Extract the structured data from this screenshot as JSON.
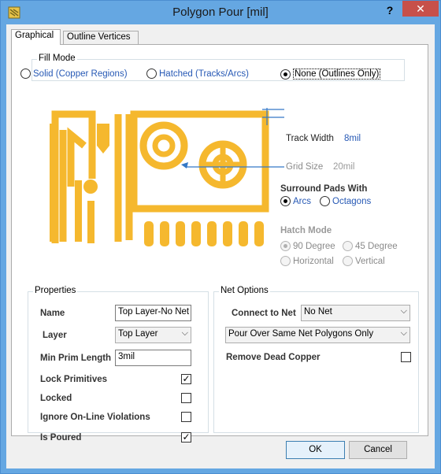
{
  "window": {
    "title": "Polygon Pour [mil]",
    "help": "?",
    "close": "✕"
  },
  "tabs": [
    {
      "label": "Graphical"
    },
    {
      "label": "Outline Vertices"
    }
  ],
  "fill_mode": {
    "title": "Fill Mode",
    "options": [
      {
        "label": "Solid (Copper Regions)",
        "checked": false
      },
      {
        "label": "Hatched (Tracks/Arcs)",
        "checked": false
      },
      {
        "label": "None (Outlines Only)",
        "checked": true
      }
    ]
  },
  "preview": {
    "track_width_label": "Track Width",
    "track_width_value": "8mil",
    "grid_size_label": "Grid Size",
    "grid_size_value": "20mil",
    "surround_label": "Surround Pads With",
    "surround_options": [
      {
        "label": "Arcs",
        "checked": true
      },
      {
        "label": "Octagons",
        "checked": false
      }
    ],
    "hatch_label": "Hatch Mode",
    "hatch_options": [
      {
        "label": "90 Degree",
        "checked": true
      },
      {
        "label": "45 Degree",
        "checked": false
      },
      {
        "label": "Horizontal",
        "checked": false
      },
      {
        "label": "Vertical",
        "checked": false
      }
    ],
    "copper_color": "#f5b82e"
  },
  "properties": {
    "title": "Properties",
    "name_label": "Name",
    "name_value": "Top Layer-No Net",
    "layer_label": "Layer",
    "layer_value": "Top Layer",
    "min_prim_label": "Min Prim Length",
    "min_prim_value": "3mil",
    "lock_primitives_label": "Lock Primitives",
    "locked_label": "Locked",
    "ignore_label": "Ignore On-Line Violations",
    "is_poured_label": "Is Poured",
    "lock_primitives": "✓",
    "locked": "",
    "ignore": "",
    "is_poured": "✓"
  },
  "net_options": {
    "title": "Net Options",
    "connect_label": "Connect to Net",
    "connect_value": "No Net",
    "pour_value": "Pour Over Same Net Polygons Only",
    "remove_dead_label": "Remove Dead Copper",
    "remove_dead": ""
  },
  "buttons": {
    "ok": "OK",
    "cancel": "Cancel"
  }
}
